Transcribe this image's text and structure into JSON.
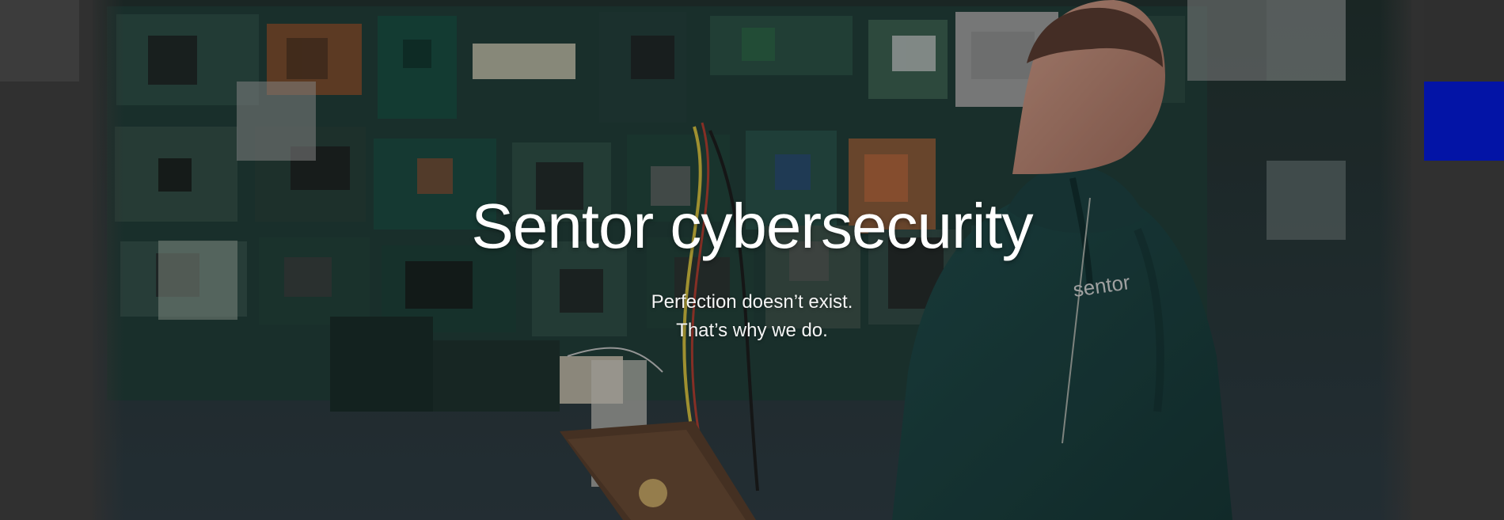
{
  "hero": {
    "title": "Sentor cybersecurity",
    "subtitle_line_1": "Perfection doesn’t exist.",
    "subtitle_line_2": "That’s why we do.",
    "logo_on_hoodie": "sentor"
  },
  "colors": {
    "page_background": "#303030",
    "accent_block": "#0314a6",
    "hero_text": "#ffffff"
  }
}
